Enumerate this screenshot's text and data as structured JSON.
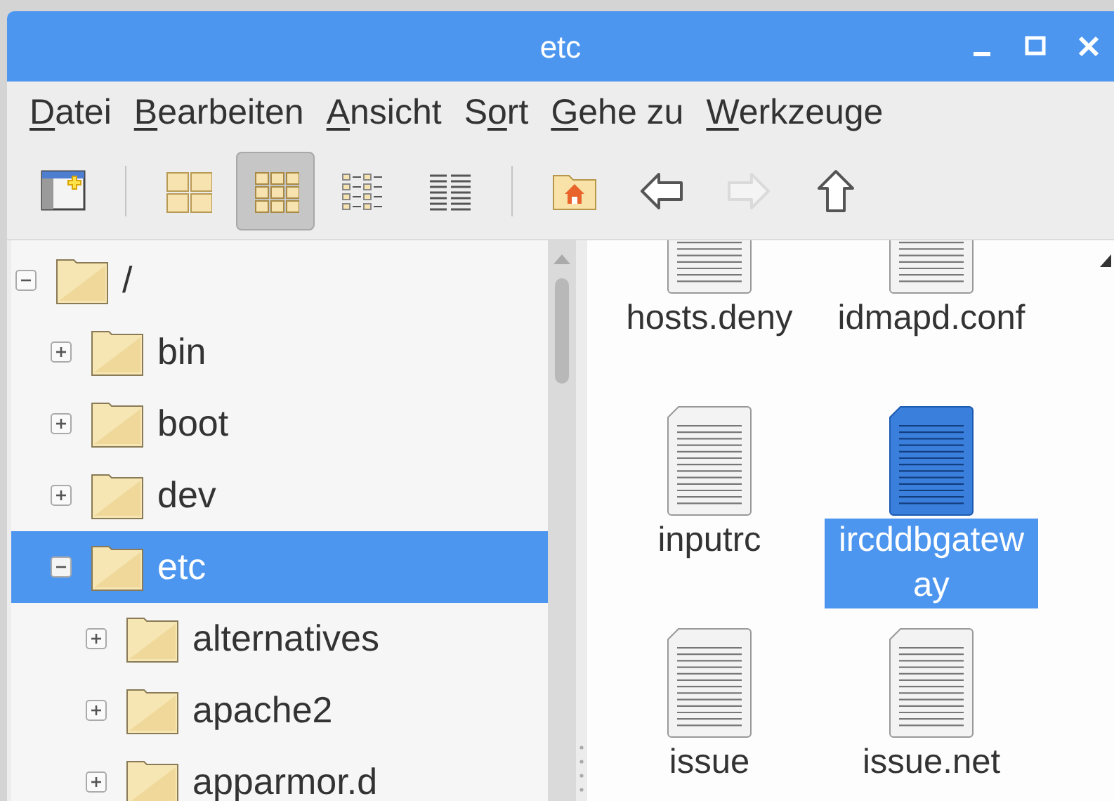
{
  "window": {
    "title": "etc"
  },
  "menu": [
    {
      "key": "D",
      "post": "atei"
    },
    {
      "key": "B",
      "post": "earbeiten"
    },
    {
      "key": "A",
      "post": "nsicht"
    },
    {
      "pre": "S",
      "key": "o",
      "post": "rt"
    },
    {
      "key": "G",
      "post": "ehe zu"
    },
    {
      "key": "W",
      "post": "erkzeuge"
    }
  ],
  "toolbar": [
    {
      "kind": "newwindow",
      "selected": false,
      "disabled": false
    },
    {
      "kind": "separator"
    },
    {
      "kind": "bigicons",
      "selected": false,
      "disabled": false
    },
    {
      "kind": "thumbnails",
      "selected": true,
      "disabled": false
    },
    {
      "kind": "compact",
      "selected": false,
      "disabled": false
    },
    {
      "kind": "list",
      "selected": false,
      "disabled": false
    },
    {
      "kind": "separator"
    },
    {
      "kind": "home",
      "selected": false,
      "disabled": false
    },
    {
      "kind": "back",
      "selected": false,
      "disabled": false
    },
    {
      "kind": "forward",
      "selected": false,
      "disabled": true
    },
    {
      "kind": "up",
      "selected": false,
      "disabled": false
    }
  ],
  "tree": [
    {
      "label": "/",
      "expanded": true,
      "selected": false,
      "children": [
        {
          "label": "bin",
          "expanded": false,
          "selected": false
        },
        {
          "label": "boot",
          "expanded": false,
          "selected": false
        },
        {
          "label": "dev",
          "expanded": false,
          "selected": false
        },
        {
          "label": "etc",
          "expanded": true,
          "selected": true,
          "children": [
            {
              "label": "alternatives",
              "expanded": false,
              "selected": false
            },
            {
              "label": "apache2",
              "expanded": false,
              "selected": false
            },
            {
              "label": "apparmor.d",
              "expanded": false,
              "selected": false
            }
          ]
        }
      ]
    }
  ],
  "files": [
    {
      "name": "hosts.deny",
      "selected": false
    },
    {
      "name": "idmapd.conf",
      "selected": false
    },
    {
      "name": "inputrc",
      "selected": false
    },
    {
      "name": "ircddbgateway",
      "selected": true
    },
    {
      "name": "issue",
      "selected": false
    },
    {
      "name": "issue.net",
      "selected": false
    }
  ]
}
